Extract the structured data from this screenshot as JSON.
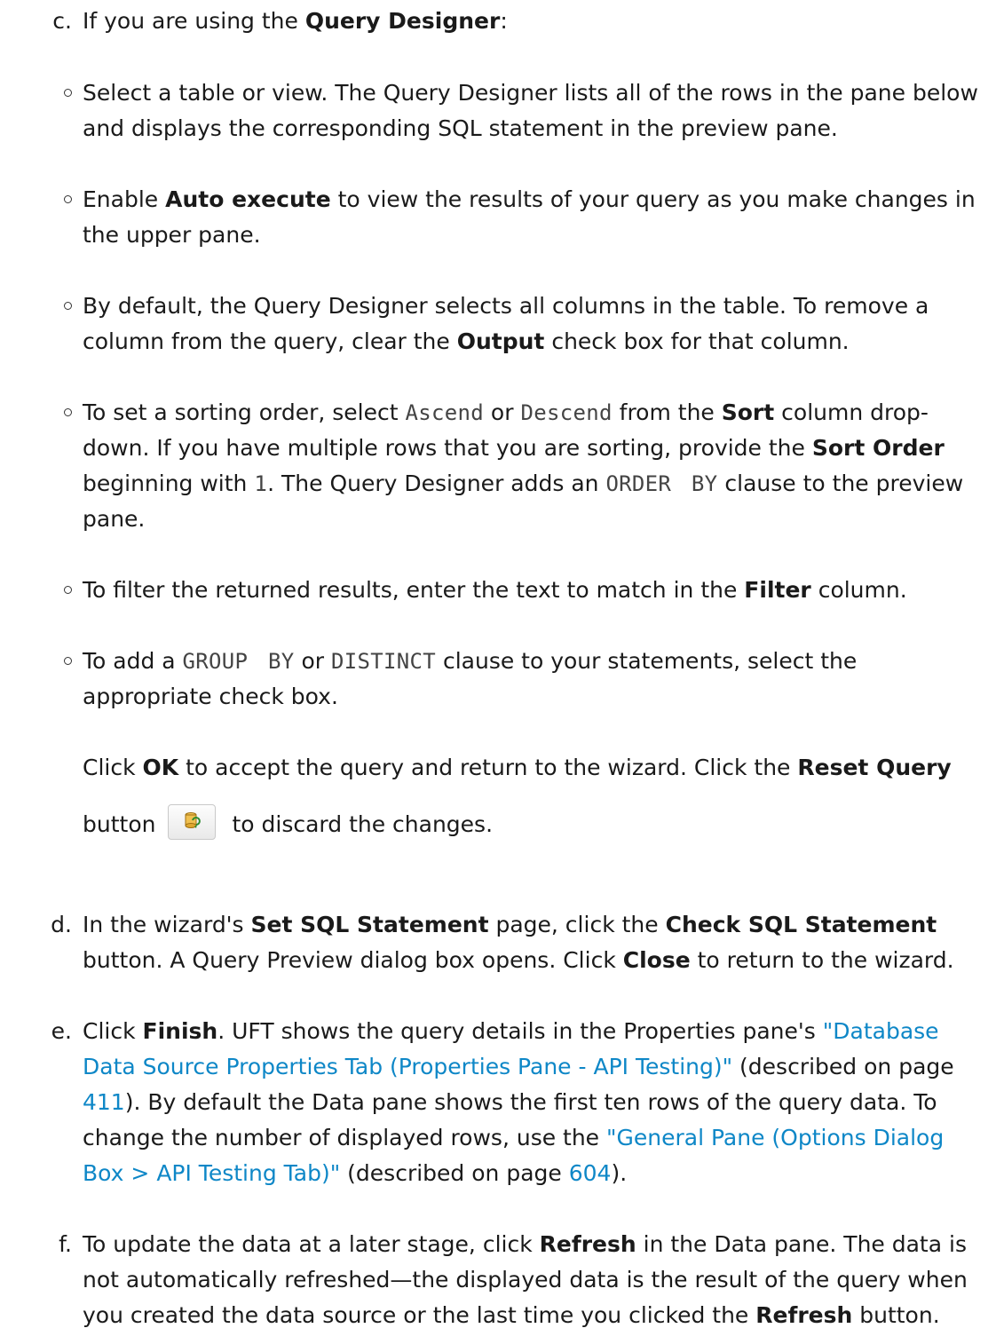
{
  "step_c": {
    "marker": "c.",
    "t1": "If you are using the ",
    "b1": "Query Designer",
    "t2": ":"
  },
  "bullet1": {
    "text": "Select a table or view. The Query Designer lists all of the rows in the pane below and displays the corresponding SQL statement in the preview pane."
  },
  "bullet2": {
    "t1": "Enable ",
    "b1": "Auto execute",
    "t2": " to view the results of your query as you make changes in the upper pane."
  },
  "bullet3": {
    "t1": "By default, the Query Designer selects all columns in the table. To remove a column from the query, clear the ",
    "b1": "Output",
    "t2": " check box for that column."
  },
  "bullet4": {
    "t1": "To set a sorting order, select ",
    "c1": "Ascend",
    "t2": " or ",
    "c2": "Descend",
    "t3": " from the ",
    "b1": "Sort",
    "t4": " column drop-down. If you have multiple rows that you are sorting, provide the ",
    "b2": "Sort Order",
    "t5": " beginning with ",
    "c3": "1",
    "t6": ". The Query Designer adds an ",
    "c4": "ORDER BY",
    "t7": " clause to the preview pane."
  },
  "bullet5": {
    "t1": "To filter the returned results, enter the text to match in the ",
    "b1": "Filter",
    "t2": " column."
  },
  "bullet6": {
    "t1": "To add a ",
    "c1": "GROUP BY",
    "t2": " or ",
    "c2": "DISTINCT",
    "t3": " clause to your statements, select the appropriate check box."
  },
  "note": {
    "t1": "Click ",
    "b1": "OK",
    "t2": " to accept the query and return to the wizard. Click the ",
    "b2": "Reset Query",
    "t3": " button",
    "t4": "to discard the changes.",
    "icon": "reset-query-icon"
  },
  "step_d": {
    "marker": "d.",
    "t1": "In the wizard's ",
    "b1": "Set SQL Statement",
    "t2": " page, click the ",
    "b2": "Check SQL Statement",
    "t3": " button. A Query Preview dialog box opens. Click ",
    "b3": "Close",
    "t4": " to return to the wizard."
  },
  "step_e": {
    "marker": "e.",
    "t1": "Click ",
    "b1": "Finish",
    "t2": ". UFT shows the query details in the Properties pane's ",
    "l1": "\"Database Data Source Properties Tab (Properties Pane - API Testing)\"",
    "t3": " (described on page ",
    "l2": "411",
    "t4": "). By default the Data pane shows the first ten rows of the query data. To change the number of displayed rows, use the ",
    "l3": "\"General Pane (Options Dialog Box > API Testing Tab)\"",
    "t5": " (described on page ",
    "l4": "604",
    "t6": ")."
  },
  "step_f": {
    "marker": "f.",
    "t1": "To update the data at a later stage, click ",
    "b1": "Refresh",
    "t2": " in the Data pane. The data is not automatically refreshed—the displayed data is the result of the query when you created the data source or the last time you clicked the ",
    "b2": "Refresh",
    "t3": " button."
  },
  "colors": {
    "text": "#1a1a1a",
    "link": "#0e87c7",
    "code": "#444444"
  }
}
